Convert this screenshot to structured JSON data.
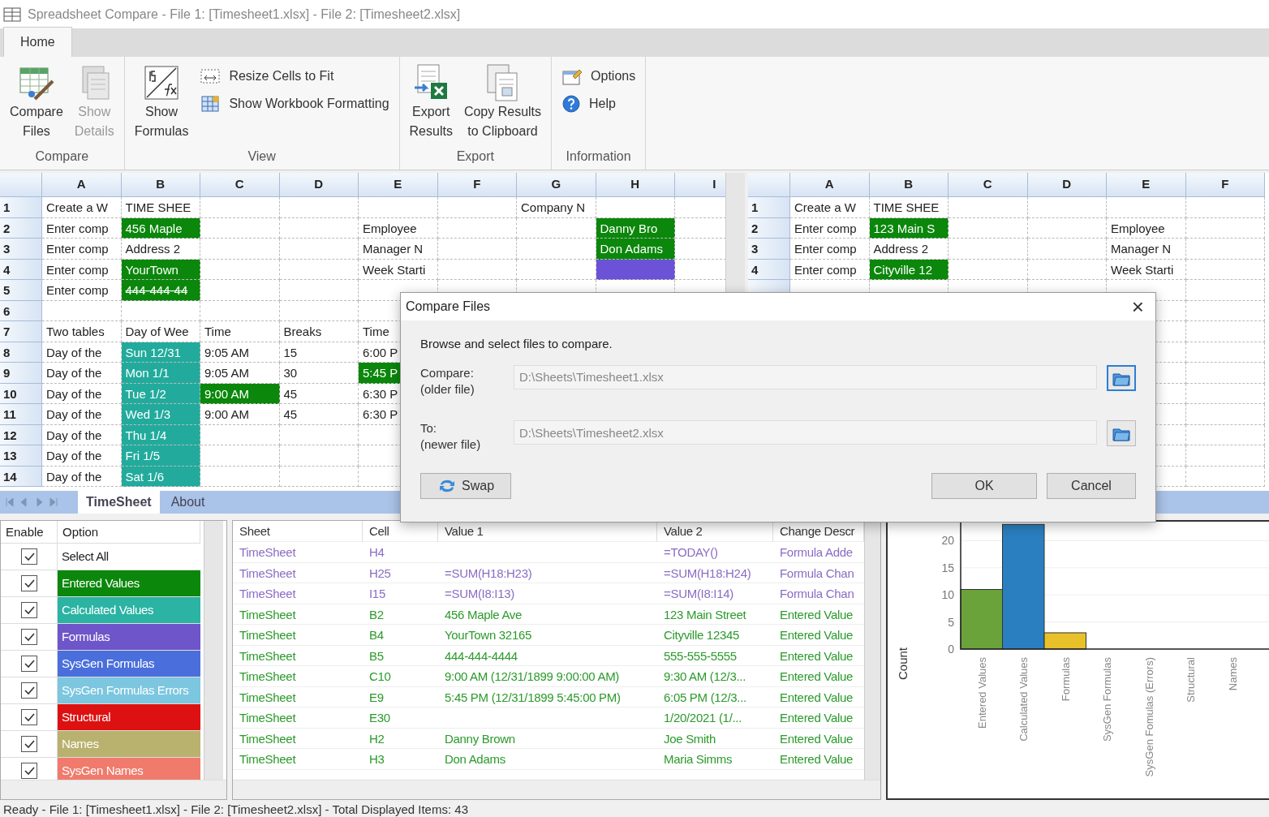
{
  "window": {
    "title": "Spreadsheet Compare - File 1: [Timesheet1.xlsx] - File 2: [Timesheet2.xlsx]"
  },
  "ribbon": {
    "tabs": [
      {
        "label": "Home",
        "selected": true
      }
    ],
    "groups": [
      {
        "name": "Compare",
        "items": [
          {
            "kind": "large",
            "label": "Compare\nFiles",
            "disabled": false
          },
          {
            "kind": "large",
            "label": "Show\nDetails",
            "disabled": true
          }
        ]
      },
      {
        "name": "View",
        "items": [
          {
            "kind": "large",
            "label": "Show\nFormulas",
            "disabled": false
          },
          {
            "kind": "small",
            "label": "Resize Cells to Fit",
            "disabled": false
          },
          {
            "kind": "small",
            "label": "Show Workbook Formatting",
            "disabled": false
          }
        ]
      },
      {
        "name": "Export",
        "items": [
          {
            "kind": "large",
            "label": "Export\nResults",
            "disabled": false
          },
          {
            "kind": "large",
            "label": "Copy Results\nto Clipboard",
            "disabled": false
          }
        ]
      },
      {
        "name": "Information",
        "items": [
          {
            "kind": "small",
            "label": "Options",
            "disabled": false
          },
          {
            "kind": "small",
            "label": "Help",
            "disabled": false
          }
        ]
      }
    ]
  },
  "grid_left": {
    "columns": [
      "A",
      "B",
      "C",
      "D",
      "E",
      "F",
      "G",
      "H",
      "I"
    ],
    "rows": [
      {
        "n": "1",
        "cells": [
          "Create a W",
          "TIME SHEE",
          null,
          null,
          null,
          null,
          "Company N"
        ]
      },
      {
        "n": "2",
        "cells": [
          "Enter comp",
          {
            "text": "456 Maple",
            "color": "#0b870b"
          },
          null,
          null,
          "Employee",
          null,
          null,
          {
            "text": "Danny Bro",
            "color": "#0b870b"
          }
        ]
      },
      {
        "n": "3",
        "cells": [
          "Enter comp",
          "Address 2",
          null,
          null,
          "Manager N",
          null,
          null,
          {
            "text": "Don Adams",
            "color": "#0b870b"
          }
        ]
      },
      {
        "n": "4",
        "cells": [
          "Enter comp",
          {
            "text": "YourTown",
            "color": "#0b870b"
          },
          null,
          null,
          "Week Starti",
          null,
          null,
          {
            "color": "#6b52d6"
          }
        ]
      },
      {
        "n": "5",
        "cells": [
          "Enter comp",
          {
            "text": "444-444-44",
            "color": "#0b870b",
            "strike": true
          }
        ]
      },
      {
        "n": "6",
        "cells": []
      },
      {
        "n": "7",
        "cells": [
          "Two tables",
          "Day of Wee",
          "Time",
          "Breaks",
          "Time"
        ]
      },
      {
        "n": "8",
        "cells": [
          "Day of the",
          {
            "text": "Sun 12/31",
            "color": "#22ab9c"
          },
          "9:05 AM",
          "15",
          "6:00 P"
        ]
      },
      {
        "n": "9",
        "cells": [
          "Day of the",
          {
            "text": "Mon 1/1",
            "color": "#22ab9c"
          },
          "9:05 AM",
          "30",
          {
            "text": "5:45 P",
            "color": "#0b870b"
          }
        ]
      },
      {
        "n": "10",
        "cells": [
          "Day of the",
          {
            "text": "Tue 1/2",
            "color": "#22ab9c"
          },
          {
            "text": "9:00 AM",
            "color": "#0b870b"
          },
          "45",
          "6:30 P"
        ]
      },
      {
        "n": "11",
        "cells": [
          "Day of the",
          {
            "text": "Wed 1/3",
            "color": "#22ab9c"
          },
          "9:00 AM",
          "45",
          "6:30 P"
        ]
      },
      {
        "n": "12",
        "cells": [
          "Day of the",
          {
            "text": "Thu 1/4",
            "color": "#22ab9c"
          }
        ]
      },
      {
        "n": "13",
        "cells": [
          "Day of the",
          {
            "text": "Fri 1/5",
            "color": "#22ab9c"
          }
        ]
      },
      {
        "n": "14",
        "cells": [
          "Day of the",
          {
            "text": "Sat 1/6",
            "color": "#22ab9c"
          }
        ]
      }
    ],
    "sheet_tabs": [
      {
        "label": "TimeSheet",
        "selected": true
      },
      {
        "label": "About",
        "selected": false
      }
    ]
  },
  "grid_right": {
    "columns": [
      "A",
      "B",
      "C",
      "D",
      "E",
      "F"
    ],
    "rows": [
      {
        "n": "1",
        "cells": [
          "Create a W",
          "TIME SHEE"
        ]
      },
      {
        "n": "2",
        "cells": [
          "Enter comp",
          {
            "text": "123 Main S",
            "color": "#0b870b"
          },
          null,
          null,
          "Employee"
        ]
      },
      {
        "n": "3",
        "cells": [
          "Enter comp",
          "Address 2",
          null,
          null,
          "Manager N"
        ]
      },
      {
        "n": "4",
        "cells": [
          "Enter comp",
          {
            "text": "Cityville 12",
            "color": "#0b870b"
          },
          null,
          null,
          "Week Starti"
        ]
      }
    ]
  },
  "options": {
    "columns": [
      "Enable",
      "Option"
    ],
    "items": [
      {
        "label": "Select All",
        "checked": true
      },
      {
        "label": "Entered Values",
        "checked": true,
        "color": "#0b870b"
      },
      {
        "label": "Calculated Values",
        "checked": true,
        "color": "#2bb3a3"
      },
      {
        "label": "Formulas",
        "checked": true,
        "color": "#6e55c9"
      },
      {
        "label": "SysGen Formulas",
        "checked": true,
        "color": "#4a6fdc"
      },
      {
        "label": "SysGen Formulas Errors",
        "checked": true,
        "color": "#7cc6e0"
      },
      {
        "label": "Structural",
        "checked": true,
        "color": "#dd1111"
      },
      {
        "label": "Names",
        "checked": true,
        "color": "#b9b16e"
      },
      {
        "label": "SysGen Names",
        "checked": true,
        "color": "#f07b6c"
      }
    ]
  },
  "changes": {
    "columns": [
      "Sheet",
      "Cell",
      "Value 1",
      "Value 2",
      "Change Descr"
    ],
    "rows": [
      {
        "color": "#8a6cc4",
        "cells": [
          "TimeSheet",
          "H4",
          null,
          "=TODAY()",
          "Formula Adde"
        ]
      },
      {
        "color": "#8a6cc4",
        "cells": [
          "TimeSheet",
          "H25",
          "=SUM(H18:H23)",
          "=SUM(H18:H24)",
          "Formula Chan"
        ]
      },
      {
        "color": "#8a6cc4",
        "cells": [
          "TimeSheet",
          "I15",
          "=SUM(I8:I13)",
          "=SUM(I8:I14)",
          "Formula Chan"
        ]
      },
      {
        "color": "#2b9a2b",
        "cells": [
          "TimeSheet",
          "B2",
          "456 Maple Ave",
          "123 Main Street",
          "Entered Value"
        ]
      },
      {
        "color": "#2b9a2b",
        "cells": [
          "TimeSheet",
          "B4",
          "YourTown 32165",
          "Cityville 12345",
          "Entered Value"
        ]
      },
      {
        "color": "#2b9a2b",
        "cells": [
          "TimeSheet",
          "B5",
          "444-444-4444",
          "555-555-5555",
          "Entered Value"
        ]
      },
      {
        "color": "#2b9a2b",
        "cells": [
          "TimeSheet",
          "C10",
          "9:00 AM (12/31/1899 9:00:00 AM)",
          "9:30 AM (12/3...",
          "Entered Value"
        ]
      },
      {
        "color": "#2b9a2b",
        "cells": [
          "TimeSheet",
          "E9",
          "5:45 PM (12/31/1899 5:45:00 PM)",
          "6:05 PM (12/3...",
          "Entered Value"
        ]
      },
      {
        "color": "#2b9a2b",
        "cells": [
          "TimeSheet",
          "E30",
          null,
          "1/20/2021 (1/...",
          "Entered Value"
        ]
      },
      {
        "color": "#2b9a2b",
        "cells": [
          "TimeSheet",
          "H2",
          "Danny Brown",
          "Joe Smith",
          "Entered Value"
        ]
      },
      {
        "color": "#2b9a2b",
        "cells": [
          "TimeSheet",
          "H3",
          "Don Adams",
          "Maria Simms",
          "Entered Value"
        ]
      }
    ]
  },
  "chart": {
    "chart_data": {
      "type": "bar",
      "ylabel": "Count",
      "categories": [
        "Entered Values",
        "Calculated Values",
        "Formulas",
        "SysGen Formulas",
        "SysGen Fomulas (Errors)",
        "Structural",
        "Names"
      ],
      "values": [
        11,
        23,
        3,
        0,
        0,
        0,
        0
      ],
      "colors": [
        "#6aa33a",
        "#2a7fc0",
        "#e8c12a",
        "#888888",
        "#888888",
        "#888888",
        "#888888"
      ],
      "grid": true,
      "ylim": [
        0,
        25
      ],
      "yticks": [
        0,
        5,
        10,
        15,
        20
      ]
    }
  },
  "dialog": {
    "title": "Compare Files",
    "close": "×",
    "intro": "Browse and select files to compare.",
    "fields": [
      {
        "label": "Compare:",
        "sublabel": "(older file)",
        "value": "D:\\Sheets\\Timesheet1.xlsx",
        "focused": true
      },
      {
        "label": "To:",
        "sublabel": "(newer file)",
        "value": "D:\\Sheets\\Timesheet2.xlsx",
        "focused": false
      }
    ],
    "swap": "Swap",
    "ok": "OK",
    "cancel": "Cancel"
  },
  "status_bar": "Ready - File 1: [Timesheet1.xlsx] - File 2: [Timesheet2.xlsx] - Total Displayed Items: 43"
}
